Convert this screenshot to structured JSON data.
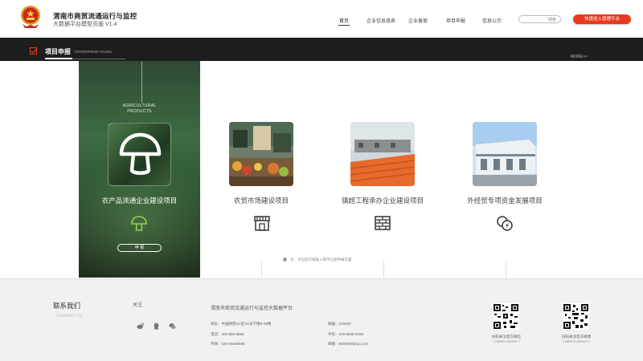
{
  "header": {
    "site_title": "渭南市商贸流通运行与监控",
    "site_subtitle": "大数据平台模型页面 V1.4",
    "nav": [
      {
        "label": "首页",
        "active": true
      },
      {
        "label": "企业信息填表",
        "active": false
      },
      {
        "label": "企业备案",
        "active": false
      },
      {
        "label": "项目申报",
        "active": false
      },
      {
        "label": "信息公示",
        "active": false
      }
    ],
    "search_placeholder": "搜索",
    "cta_label": "快速进入管理平台"
  },
  "section": {
    "title": "项目申报",
    "title_en": "/ ENTERPRISE FILING",
    "more": "MORE>>"
  },
  "featured": {
    "category_line1": "AGRICULTURAL",
    "category_line2": "PRODUCTS",
    "name": "农产品流通企业建设项目",
    "button": "申 报",
    "icon": "mushroom-icon"
  },
  "projects": [
    {
      "name": "农贸市场建设项目",
      "icon": "market-stall-icon"
    },
    {
      "name": "镇超工程承办企业建设项目",
      "icon": "brick-wall-icon"
    },
    {
      "name": "外经贸专项资金发展项目",
      "icon": "coins-icon"
    }
  ],
  "note": "注：点击后可根据入网平信息申报页面",
  "footer": {
    "contact_title": "联系我们",
    "contact_en": "Contact Us",
    "follow": "关注",
    "social_icons": [
      "weibo-icon",
      "qq-icon",
      "wechat-icon"
    ],
    "platform_name": "渭南市商贸流通运行与监控大数据平台",
    "address": "地址：中国陕西XX区XX号学楼B-88楼",
    "phone": "电话：400-888-8888",
    "fax": "传真：020-66668888",
    "postcode": "邮编：100000",
    "mobile": "手机：188-8888-5188",
    "email": "邮箱：8008008@qq.com",
    "qr": [
      {
        "caption": "扫码关注官方微信",
        "sub": "（ HARRY-DESHY ）"
      },
      {
        "caption": "扫码关注官方微博",
        "sub": "（ HARRY-DESHY ）"
      }
    ]
  },
  "colors": {
    "accent_red": "#e8391f",
    "dark_bar": "#1d1d1d",
    "featured_green": "#3d6b42",
    "footer_bg": "#f1f1f1"
  }
}
